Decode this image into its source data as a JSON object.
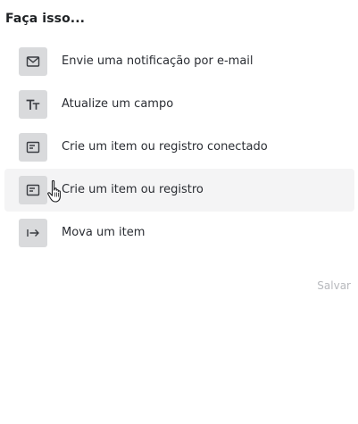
{
  "panel": {
    "heading": "Faça isso..."
  },
  "actions": [
    {
      "label": "Envie uma notificação por e-mail",
      "icon": "mail-icon"
    },
    {
      "label": "Atualize um campo",
      "icon": "text-format-icon"
    },
    {
      "label": "Crie um item ou registro conectado",
      "icon": "record-icon"
    },
    {
      "label": "Crie um item ou registro",
      "icon": "record-icon",
      "hovered": true
    },
    {
      "label": "Mova um item",
      "icon": "move-arrow-icon"
    }
  ],
  "footer": {
    "save_label": "Salvar"
  },
  "colors": {
    "icon_background": "#d9dadc",
    "hover_background": "#f4f4f5",
    "disabled_text": "#b7b9bd"
  }
}
